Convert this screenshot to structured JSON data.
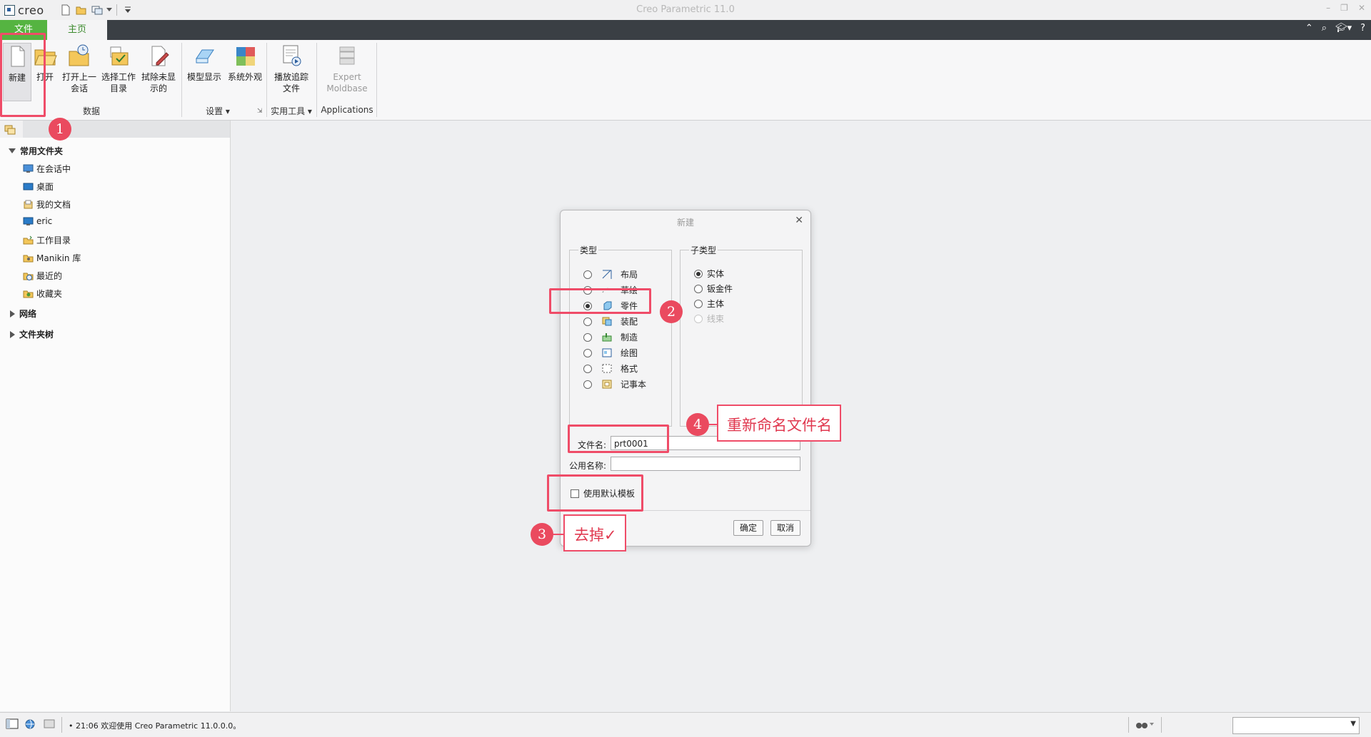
{
  "app": {
    "logo_text": "creo",
    "title": "Creo Parametric 11.0",
    "window_controls": [
      "–",
      "❐",
      "✕"
    ]
  },
  "tabs": {
    "file": "文件",
    "home": "主页",
    "right_icons": [
      "chevron-up-icon",
      "search-icon",
      "graduation-icon",
      "question-icon"
    ]
  },
  "ribbon": {
    "buttons": {
      "new": "新建",
      "open": "打开",
      "open_last_line1": "打开上一",
      "open_last_line2": "会话",
      "select_wd_line1": "选择工作",
      "select_wd_line2": "目录",
      "erase_line1": "拭除未显",
      "erase_line2": "示的",
      "model_display": "模型显示",
      "system_appearance": "系统外观",
      "playback_line1": "播放追踪",
      "playback_line2": "文件",
      "expert_line1": "Expert",
      "expert_line2": "Moldbase"
    },
    "groups": {
      "data": "数据",
      "settings": "设置",
      "utilities": "实用工具",
      "applications": "Applications"
    }
  },
  "left_panel": {
    "common_folders": "常用文件夹",
    "items": [
      "在会话中",
      "桌面",
      "我的文档",
      "eric",
      "工作目录",
      "Manikin 库",
      "最近的",
      "收藏夹"
    ],
    "network": "网络",
    "folder_tree": "文件夹树"
  },
  "status": {
    "message": "21:06 欢迎使用 Creo Parametric 11.0.0.0。"
  },
  "dialog": {
    "title": "新建",
    "type_legend": "类型",
    "subtype_legend": "子类型",
    "types": [
      "布局",
      "草绘",
      "零件",
      "装配",
      "制造",
      "绘图",
      "格式",
      "记事本"
    ],
    "selected_type": "零件",
    "subtypes": [
      "实体",
      "钣金件",
      "主体",
      "线束"
    ],
    "selected_subtype": "实体",
    "disabled_subtype": "线束",
    "filename_label": "文件名:",
    "filename_value": "prt0001",
    "common_name_label": "公用名称:",
    "common_name_value": "",
    "use_default_template": "使用默认模板",
    "use_default_template_checked": false,
    "ok": "确定",
    "cancel": "取消"
  },
  "annotations": {
    "badge1": "1",
    "badge2": "2",
    "badge3": "3",
    "badge4": "4",
    "note3": "去掉✓",
    "note4": "重新命名文件名"
  },
  "colors": {
    "file_tab": "#55b441",
    "home_tab_text": "#3b8a2c",
    "tab_strip": "#3a3f44",
    "annotation": "#ef4c68"
  }
}
